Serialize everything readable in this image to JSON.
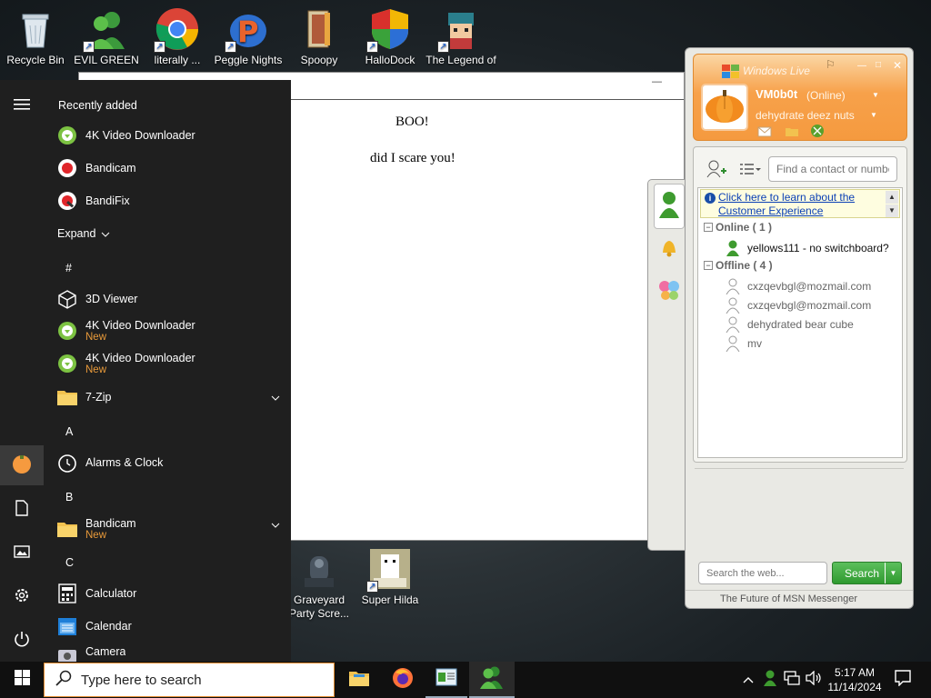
{
  "desktop": {
    "icons": [
      {
        "label": "Recycle Bin",
        "name": "recycle-bin-icon"
      },
      {
        "label": "EVIL GREEN MEN CO...",
        "name": "evil-green-men-icon"
      },
      {
        "label": "literally ...",
        "name": "chrome-icon"
      },
      {
        "label": "Peggle Nights Del...",
        "name": "peggle-nights-icon"
      },
      {
        "label": "Spoopy",
        "name": "spoopy-icon"
      },
      {
        "label": "HalloDock",
        "name": "hallodock-icon"
      },
      {
        "label": "The Legend of Tid...",
        "name": "legend-icon"
      }
    ],
    "bottom_icons": [
      {
        "label_line1": "Graveyard",
        "label_line2": "Party Scre...",
        "name": "graveyard-party-icon"
      },
      {
        "label_line1": "Super Hilda",
        "label_line2": "",
        "name": "super-hilda-icon"
      }
    ]
  },
  "notepad": {
    "line1": "BOO!",
    "line2": "did I scare you!",
    "minimize": "—"
  },
  "start_menu": {
    "recently_added": "Recently added",
    "expand": "Expand",
    "recent": [
      {
        "label": "4K Video Downloader"
      },
      {
        "label": "Bandicam"
      },
      {
        "label": "BandiFix"
      }
    ],
    "sections": {
      "hash": "#",
      "a": "A",
      "b": "B",
      "c": "C"
    },
    "apps": [
      {
        "label": "3D Viewer",
        "sub": ""
      },
      {
        "label": "4K Video Downloader",
        "sub": "New"
      },
      {
        "label": "4K Video Downloader",
        "sub": "New"
      },
      {
        "label": "7-Zip",
        "sub": ""
      },
      {
        "label": "Alarms & Clock",
        "sub": ""
      },
      {
        "label": "Bandicam",
        "sub": "New"
      },
      {
        "label": "Calculator",
        "sub": ""
      },
      {
        "label": "Calendar",
        "sub": ""
      },
      {
        "label": "Camera",
        "sub": ""
      }
    ]
  },
  "msn": {
    "title": "Windows Live",
    "username": "VM0b0t",
    "status": "(Online)",
    "personal_message": "dehydrate deez nuts",
    "find_placeholder": "Find a contact or numbe",
    "banner_line1": "Click here to learn about the",
    "banner_line2": "Customer Experience",
    "online_group": "Online ( 1 )",
    "offline_group": "Offline ( 4 )",
    "online_contacts": [
      "yellows111 - no switchboard?"
    ],
    "offline_contacts": [
      "cxzqevbgl@mozmail.com",
      "cxzqevbgl@mozmail.com",
      "dehydrated bear cube",
      "mv"
    ],
    "search_placeholder": "Search the web...",
    "search_button": "Search",
    "footer": "The Future of MSN Messenger"
  },
  "taskbar": {
    "search_placeholder": "Type here to search",
    "time": "5:17 AM",
    "date": "11/14/2024"
  },
  "colors": {
    "accent_orange": "#f59a3f",
    "new_label": "#e89a3a",
    "search_green": "#3aa23a",
    "link_blue": "#0a3fb5"
  }
}
